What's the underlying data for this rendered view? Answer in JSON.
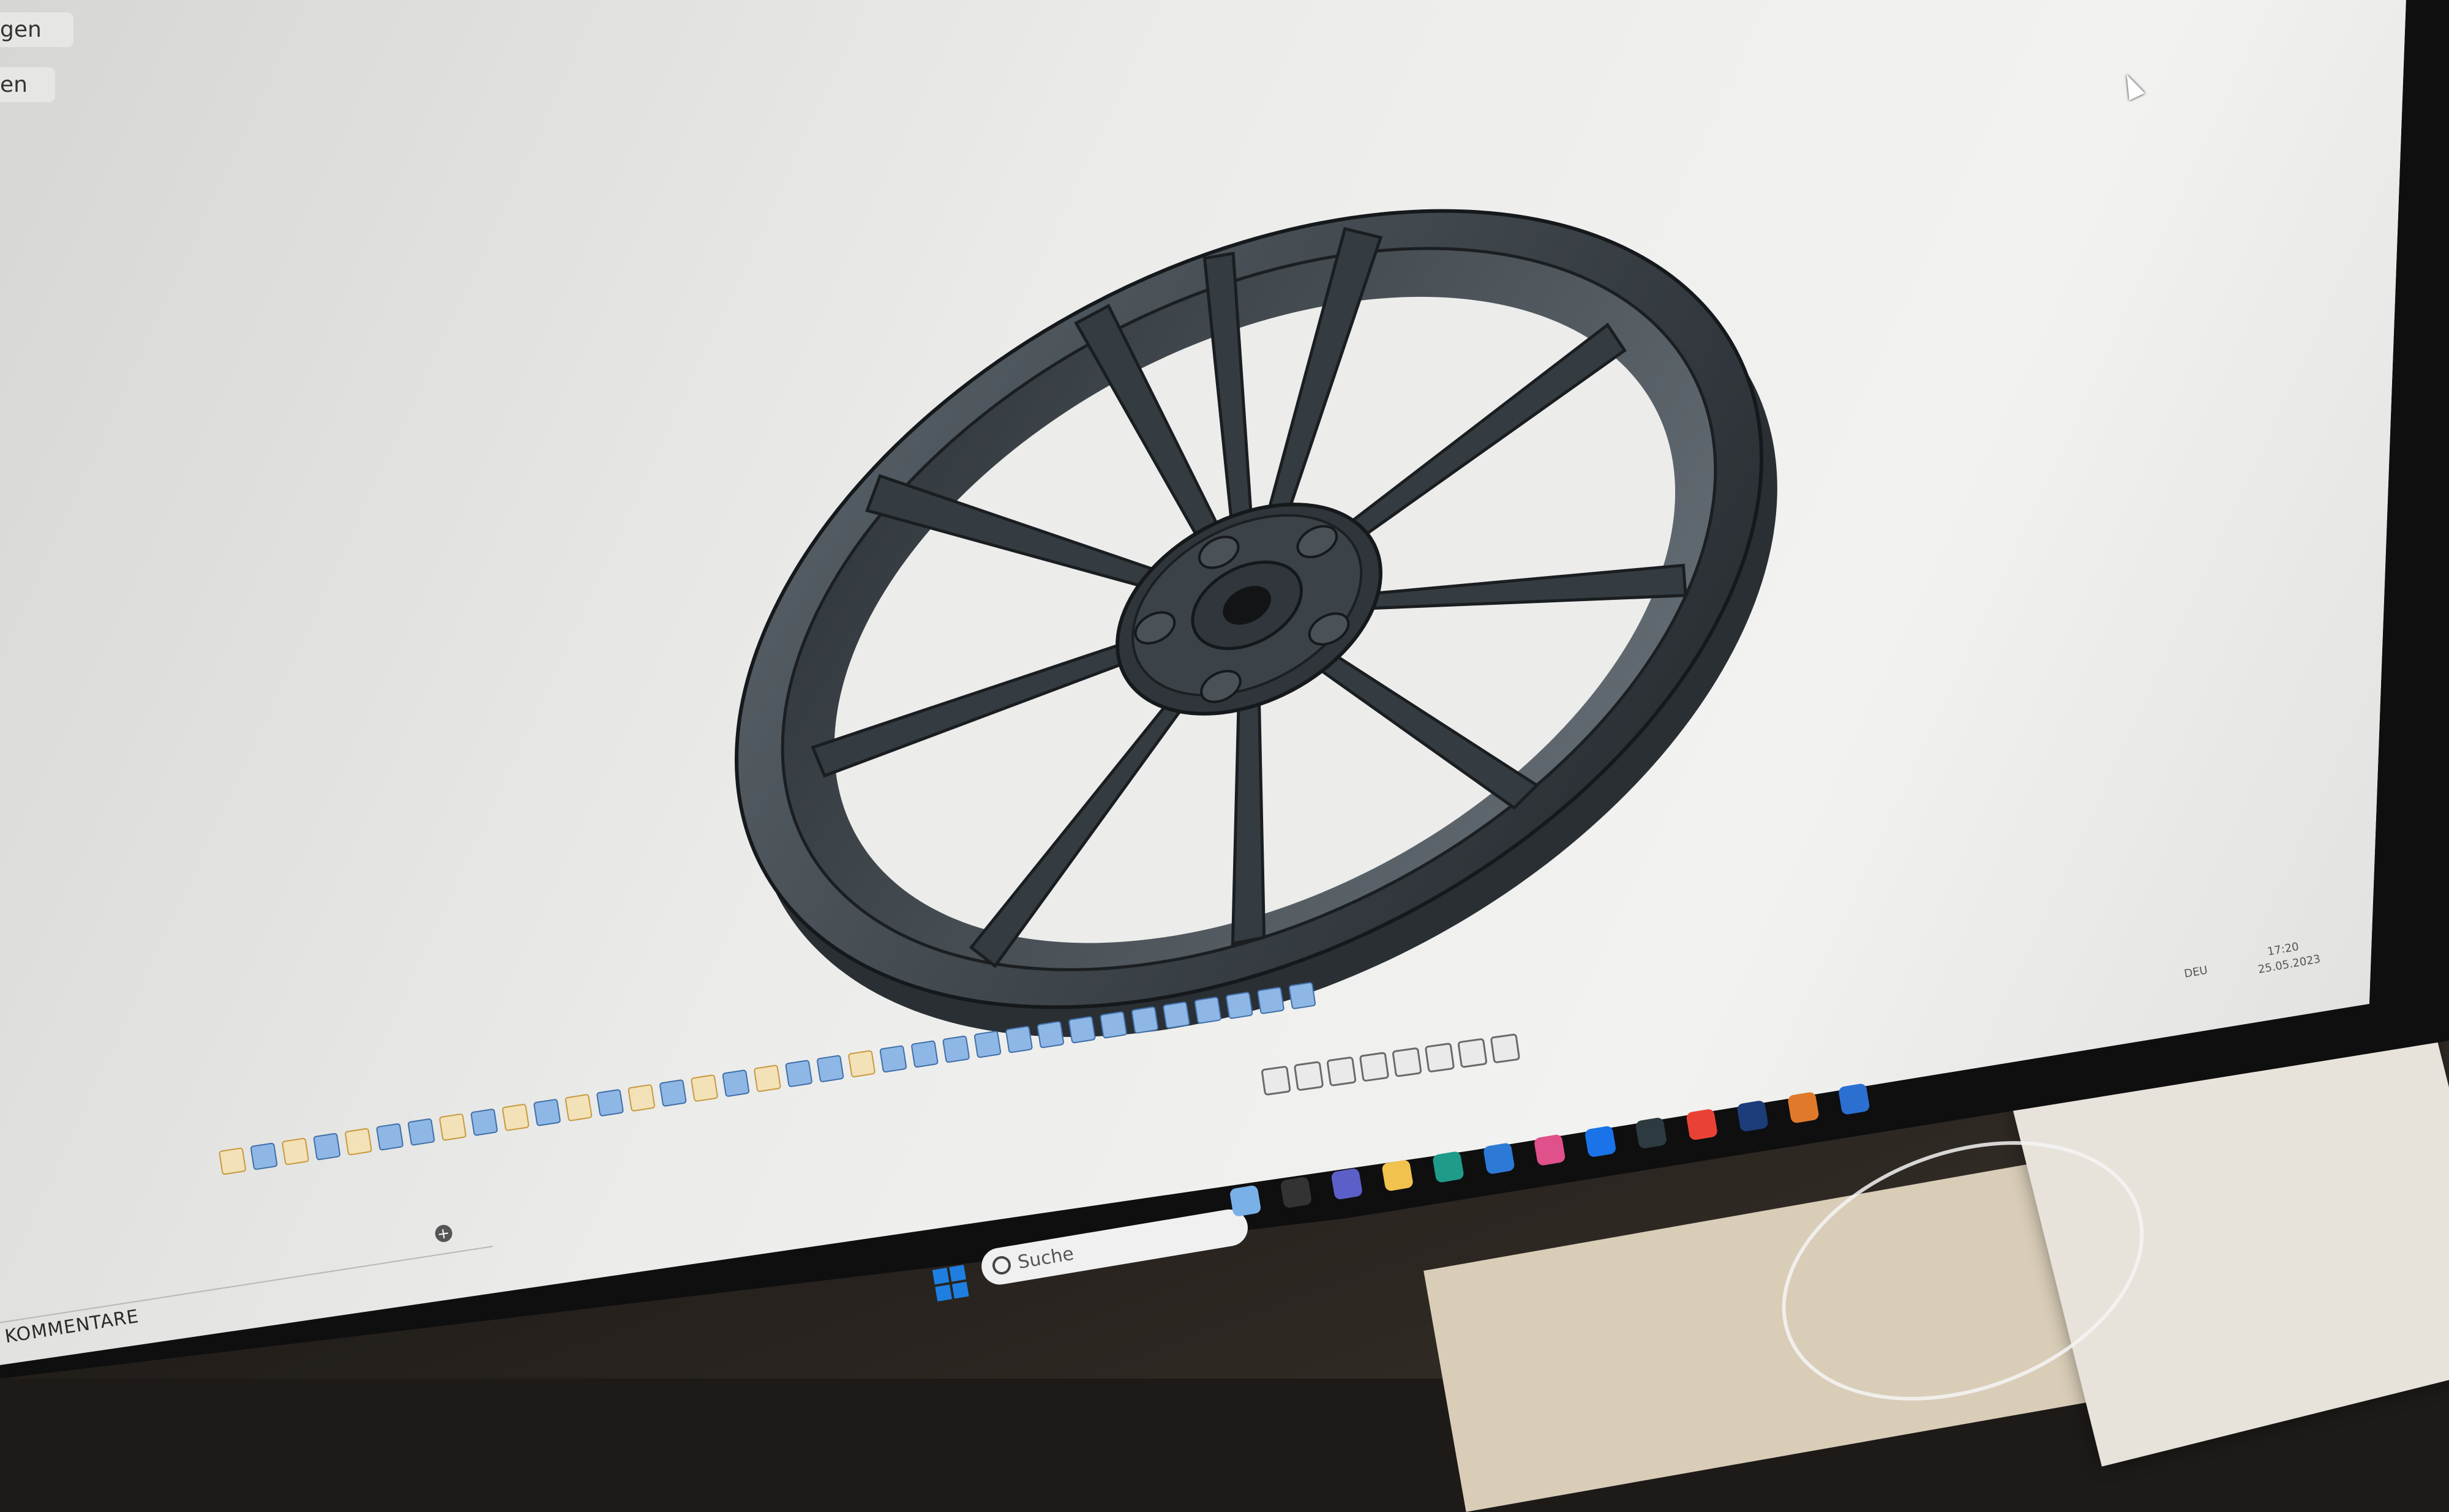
{
  "sidebar": {
    "item_1_fragment": "gen",
    "item_2_fragment": "en"
  },
  "comments_panel": {
    "label": "KOMMENTARE"
  },
  "taskbar": {
    "search_placeholder": "Suche",
    "language": "DEU",
    "time": "17:20",
    "date": "25.05.2023"
  },
  "model": {
    "object": "wheel rim",
    "spoke_count": 10,
    "lug_holes": 5,
    "color": "#3e454b"
  },
  "colors": {
    "viewport_bg": "#ececea",
    "model_dark": "#2b3136",
    "model_light": "#5c656c",
    "timeline_feature": "#8fb7e6",
    "timeline_sketch": "#f3e1b8",
    "windows_blue": "#1e7fe0"
  }
}
